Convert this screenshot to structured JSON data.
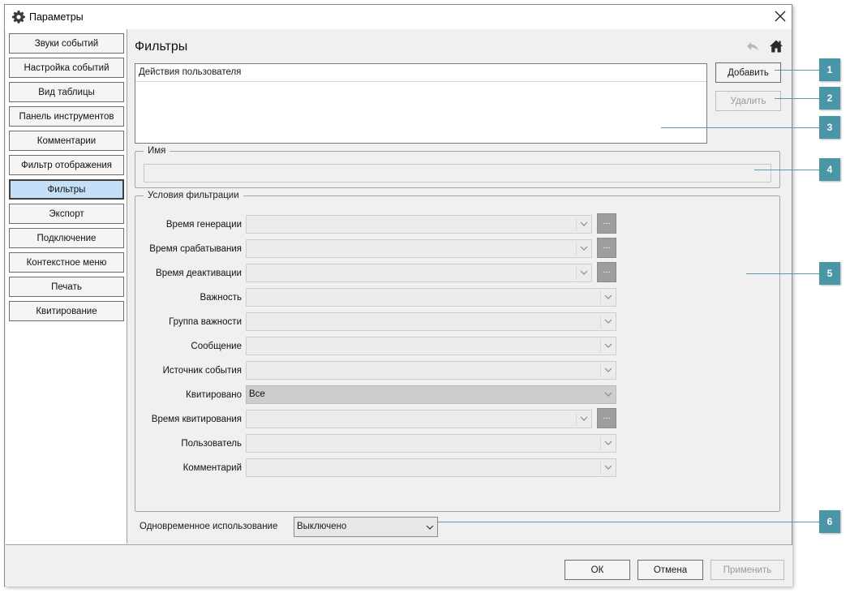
{
  "window": {
    "title": "Параметры"
  },
  "sidebar": {
    "items": [
      {
        "label": "Звуки событий",
        "active": false
      },
      {
        "label": "Настройка событий",
        "active": false
      },
      {
        "label": "Вид таблицы",
        "active": false
      },
      {
        "label": "Панель инструментов",
        "active": false
      },
      {
        "label": "Комментарии",
        "active": false
      },
      {
        "label": "Фильтр отображения",
        "active": false
      },
      {
        "label": "Фильтры",
        "active": true
      },
      {
        "label": "Экспорт",
        "active": false
      },
      {
        "label": "Подключение",
        "active": false
      },
      {
        "label": "Контекстное меню",
        "active": false
      },
      {
        "label": "Печать",
        "active": false
      },
      {
        "label": "Квитирование",
        "active": false
      }
    ]
  },
  "page": {
    "title": "Фильтры"
  },
  "filters": {
    "items": [
      "Действия пользователя"
    ],
    "add_label": "Добавить",
    "delete_label": "Удалить"
  },
  "name_group": {
    "legend": "Имя",
    "value": ""
  },
  "conditions": {
    "legend": "Условия фильтрации",
    "rows": [
      {
        "label": "Время генерации",
        "value": "",
        "has_ellipsis": true
      },
      {
        "label": "Время срабатывания",
        "value": "",
        "has_ellipsis": true
      },
      {
        "label": "Время деактивации",
        "value": "",
        "has_ellipsis": true
      },
      {
        "label": "Важность",
        "value": "",
        "has_ellipsis": false
      },
      {
        "label": "Группа важности",
        "value": "",
        "has_ellipsis": false
      },
      {
        "label": "Сообщение",
        "value": "",
        "has_ellipsis": false
      },
      {
        "label": "Источник события",
        "value": "",
        "has_ellipsis": false
      },
      {
        "label": "Квитировано",
        "value": "Все",
        "has_ellipsis": false
      },
      {
        "label": "Время квитирования",
        "value": "",
        "has_ellipsis": true
      },
      {
        "label": "Пользователь",
        "value": "",
        "has_ellipsis": false
      },
      {
        "label": "Комментарий",
        "value": "",
        "has_ellipsis": false
      }
    ],
    "ellipsis_label": "..."
  },
  "concurrent": {
    "label": "Одновременное использование",
    "value": "Выключено"
  },
  "footer": {
    "ok_label": "ОК",
    "cancel_label": "Отмена",
    "apply_label": "Применить"
  },
  "callouts": [
    "1",
    "2",
    "3",
    "4",
    "5",
    "6"
  ],
  "colors": {
    "accent_selected": "#c5dff8",
    "callout": "#4a95a6"
  }
}
